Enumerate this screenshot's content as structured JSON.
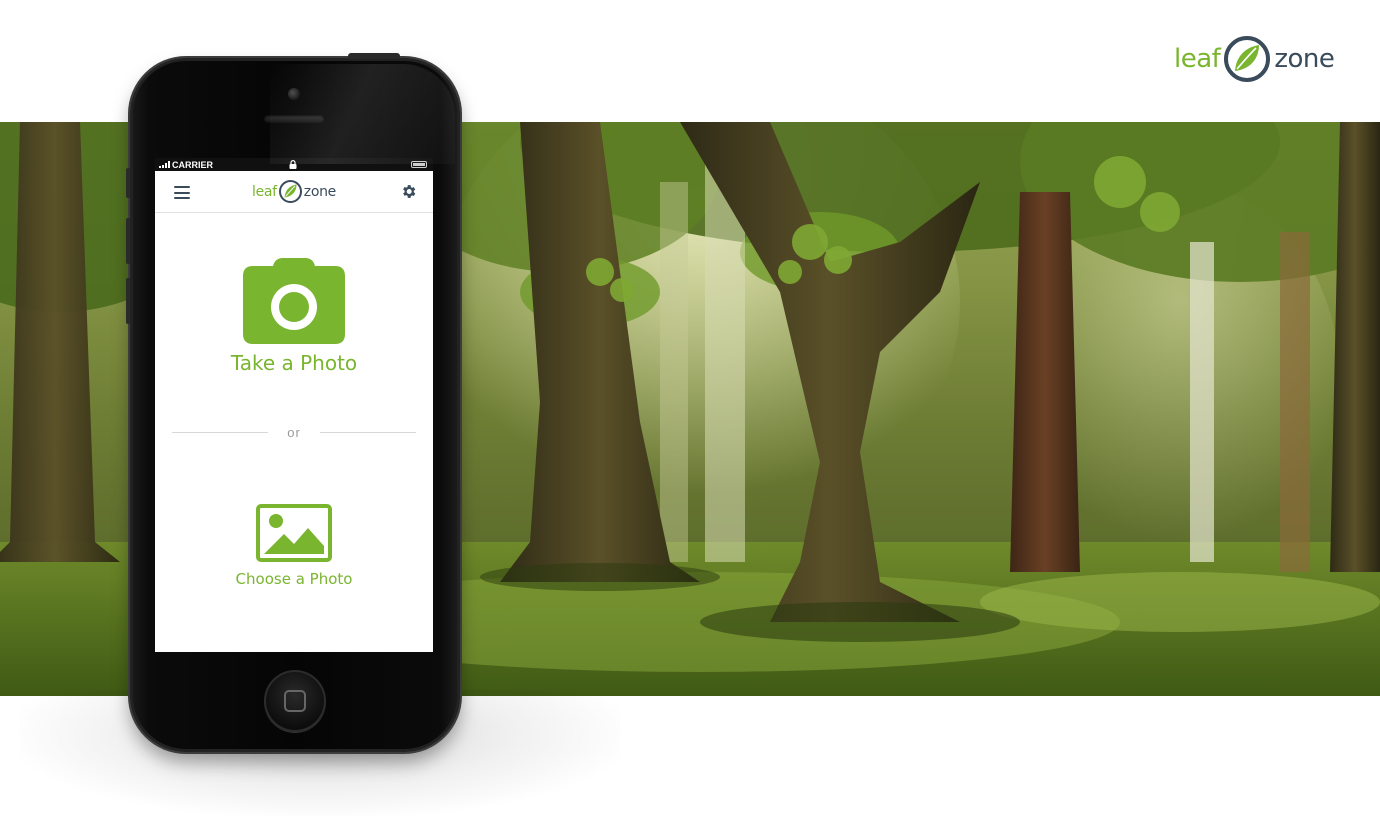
{
  "brand": {
    "word_left": "leaf",
    "word_right": "zone",
    "green": "#7ab52f",
    "slate": "#3a4b5c"
  },
  "banner": {
    "subject": "sunlit forest with large oak trees"
  },
  "phone": {
    "status_bar": {
      "carrier": "CARRIER",
      "icons": [
        "signal-icon",
        "lock-icon",
        "battery-icon"
      ]
    },
    "nav": {
      "menu_icon": "hamburger-menu-icon",
      "logo_left": "leaf",
      "logo_right": "zone",
      "settings_icon": "gear-icon"
    },
    "actions": {
      "take_photo_label": "Take a Photo",
      "take_photo_icon": "camera-icon",
      "divider_text": "or",
      "choose_photo_label": "Choose a Photo",
      "choose_photo_icon": "image-icon"
    },
    "home_button_icon": "home-square-icon"
  }
}
